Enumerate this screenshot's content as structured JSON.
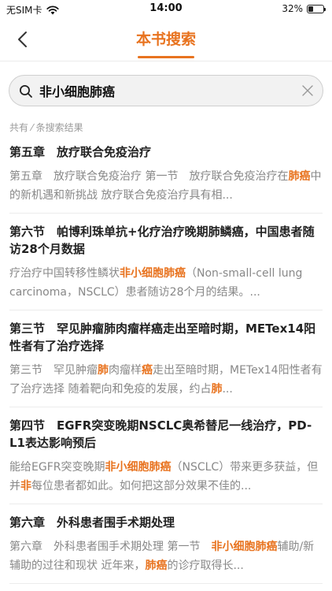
{
  "status_bar": {
    "carrier": "无SIM卡",
    "time": "14:00",
    "battery": "32%",
    "battery_level": 0.32,
    "wifi_icon": "wifi-icon"
  },
  "nav": {
    "title": "本书搜索",
    "back_icon": "chevron-left-icon"
  },
  "search": {
    "value": "非小细胞肺癌",
    "search_icon": "search-icon",
    "clear_icon": "close-icon"
  },
  "result_count": "共有 ⁄ 条搜索结果",
  "colors": {
    "accent": "#e8731f",
    "snippet_text": "#888888",
    "divider": "#ececec"
  },
  "results": [
    {
      "title": "第五章　放疗联合免疫治疗",
      "snippet": [
        {
          "t": "第五章　放疗联合免疫治疗 第一节　放疗联合免疫治疗在"
        },
        {
          "t": "肺癌",
          "hl": true
        },
        {
          "t": "中的新机遇和新挑战 放疗联合免疫治疗具有相..."
        }
      ]
    },
    {
      "title": "第六节　帕博利珠单抗+化疗治疗晚期肺鳞癌，中国患者随访28个月数据",
      "snippet": [
        {
          "t": "疗治疗中国转移性鳞状"
        },
        {
          "t": "非小细胞肺癌",
          "hl": true
        },
        {
          "t": "（Non-small-cell lung carcinoma，NSCLC）患者随访28个月的结果。..."
        }
      ]
    },
    {
      "title": "第三节　罕见肿瘤肺肉瘤样癌走出至暗时期，METex14阳性者有了治疗选择",
      "snippet": [
        {
          "t": "第三节　罕见肿瘤"
        },
        {
          "t": "肺",
          "hl": true
        },
        {
          "t": "肉瘤样"
        },
        {
          "t": "癌",
          "hl": true
        },
        {
          "t": "走出至暗时期，METex14阳性者有了治疗选择 随着靶向和免疫的发展，约占"
        },
        {
          "t": "肺",
          "hl": true
        },
        {
          "t": "..."
        }
      ]
    },
    {
      "title": "第四节　EGFR突变晚期NSCLC奥希替尼一线治疗，PD-L1表达影响预后",
      "snippet": [
        {
          "t": "能给EGFR突变晚期"
        },
        {
          "t": "非小细胞肺癌",
          "hl": true
        },
        {
          "t": "（NSCLC）带来更多获益，但并"
        },
        {
          "t": "非",
          "hl": true
        },
        {
          "t": "每位患者都如此。如何把这部分效果不佳的..."
        }
      ]
    },
    {
      "title": "第六章　外科患者围手术期处理",
      "snippet": [
        {
          "t": "第六章　外科患者围手术期处理 第一节　"
        },
        {
          "t": "非小细胞肺癌",
          "hl": true
        },
        {
          "t": "辅助/新辅助的过往和现状 近年来，"
        },
        {
          "t": "肺癌",
          "hl": true
        },
        {
          "t": "的诊疗取得长..."
        }
      ]
    }
  ]
}
